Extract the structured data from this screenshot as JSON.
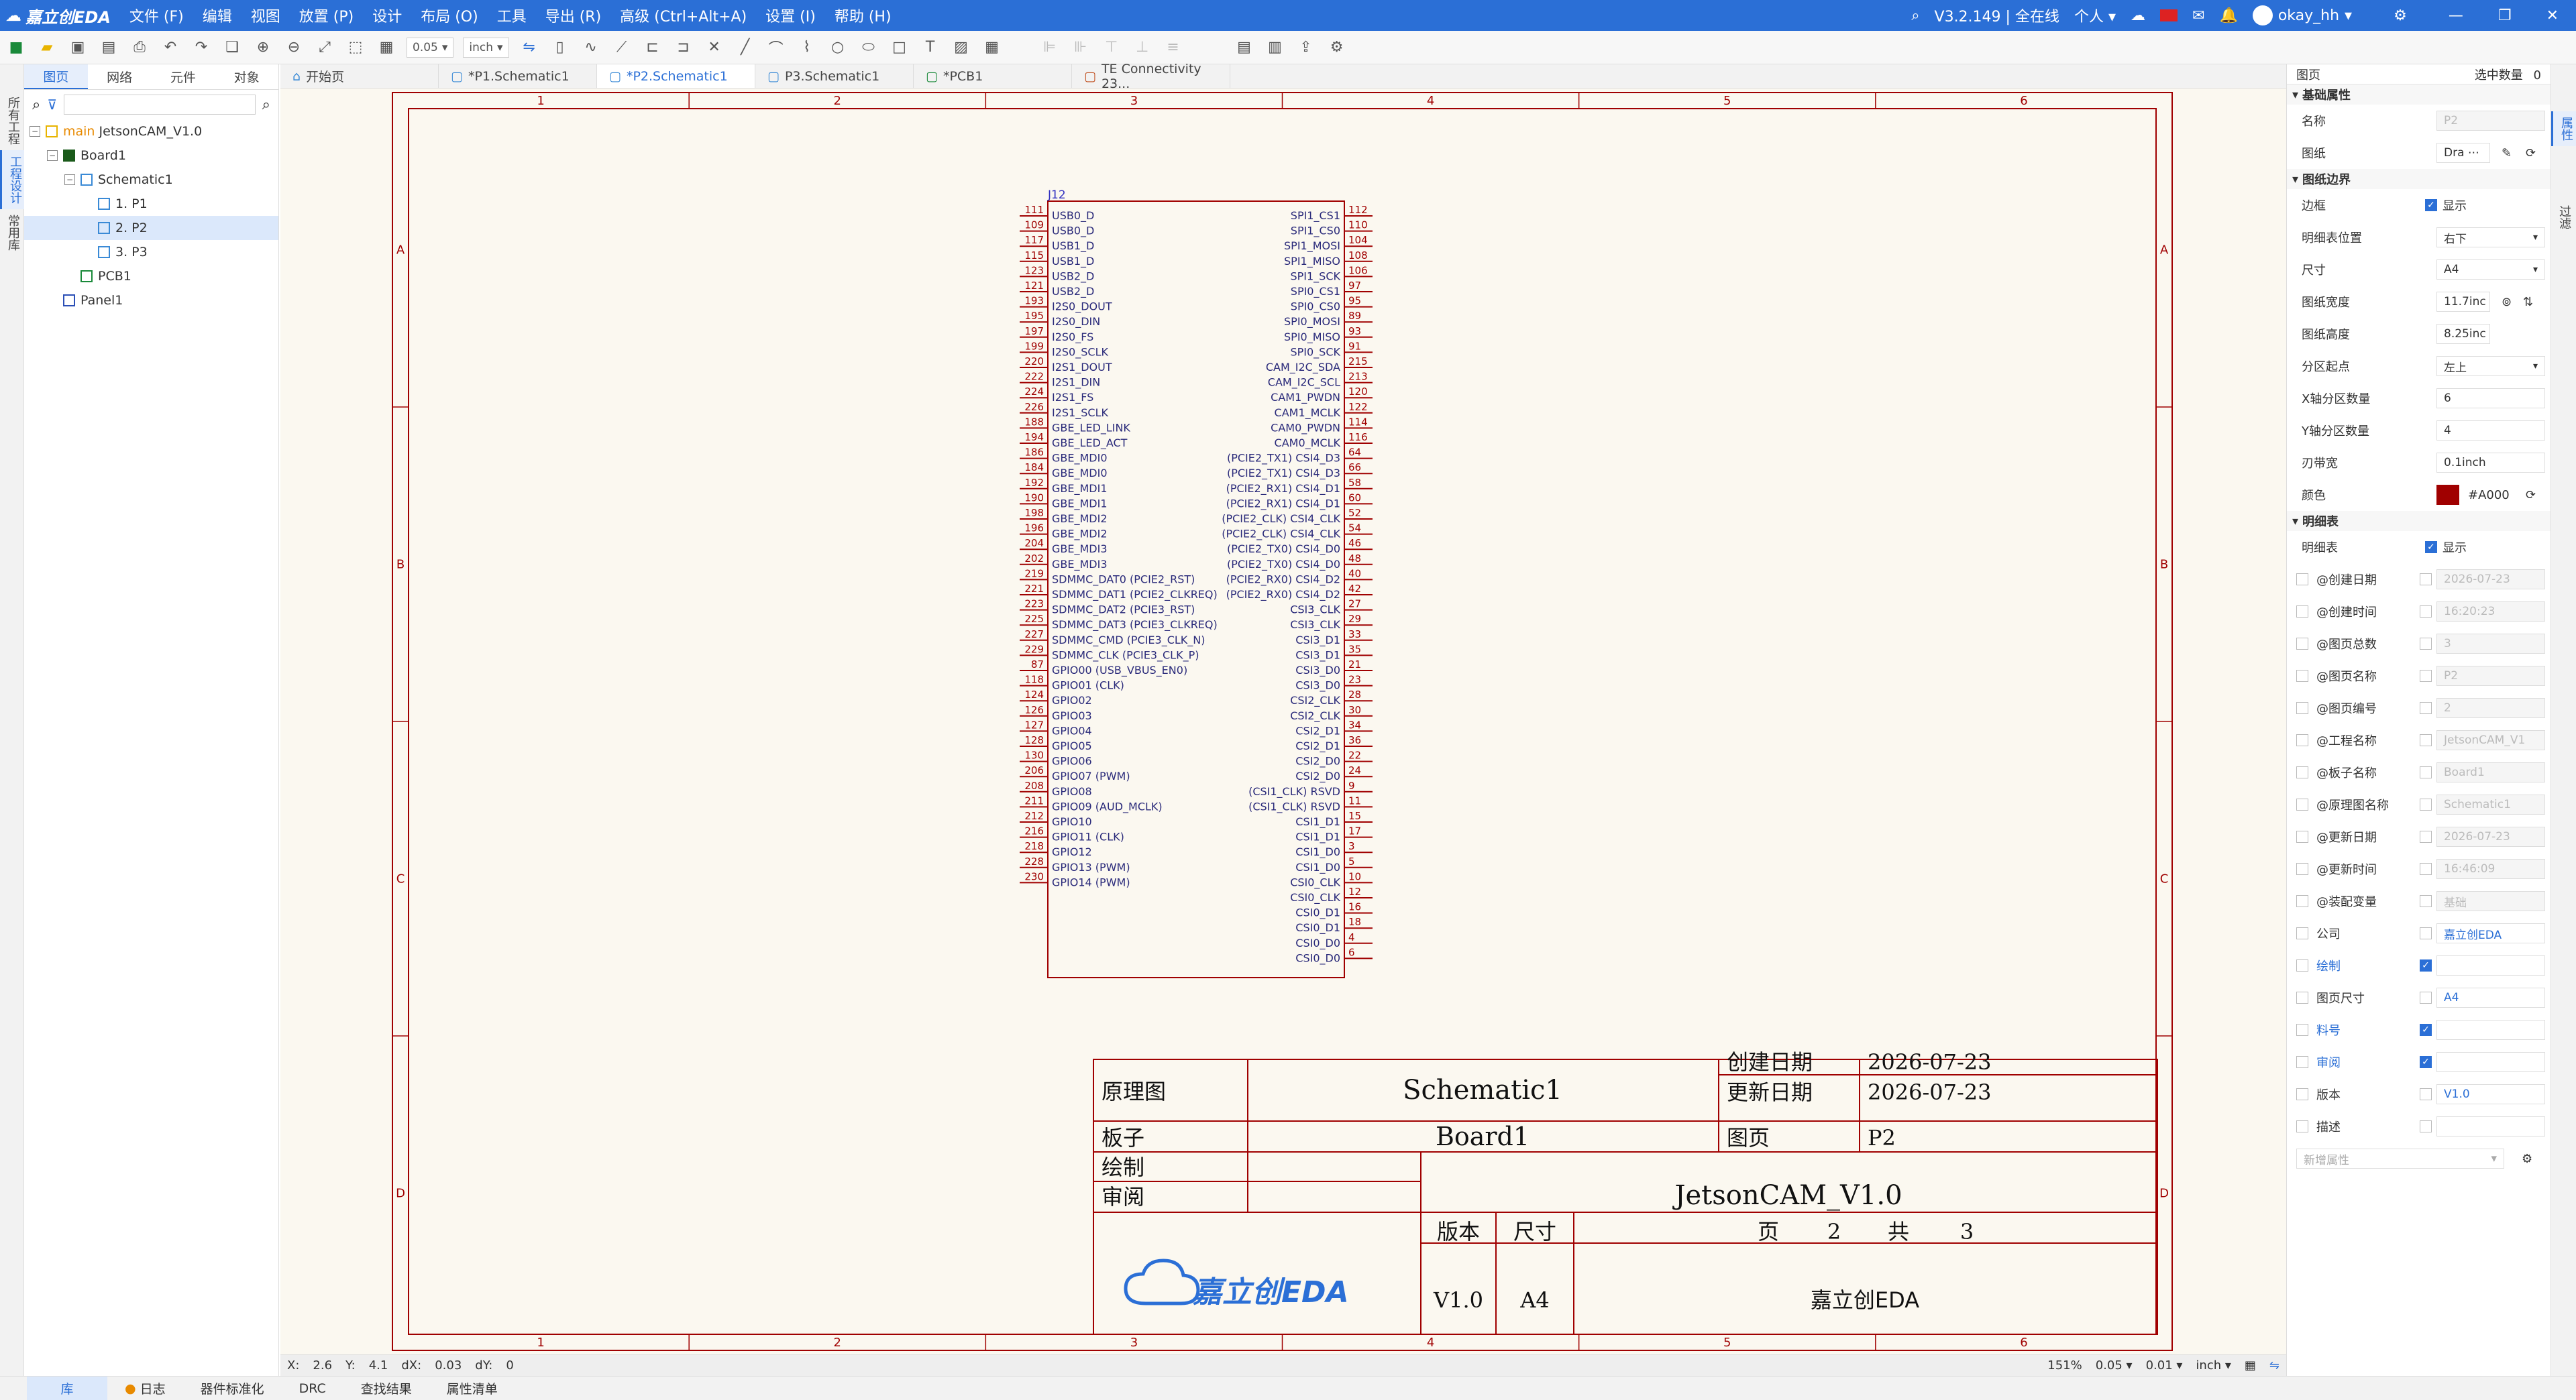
{
  "app": {
    "logo": "嘉立创EDA",
    "version": "V3.2.149 | 全在线",
    "mode": "个人",
    "user": "okay_hh"
  },
  "menus": [
    "文件 (F)",
    "编辑",
    "视图",
    "放置 (P)",
    "设计",
    "布局 (O)",
    "工具",
    "导出 (R)",
    "高级 (Ctrl+Alt+A)",
    "设置 (I)",
    "帮助 (H)"
  ],
  "toolbar": {
    "grid": "0.05",
    "unit": "inch"
  },
  "left_rail": [
    "所有工程",
    "工程设计",
    "常用库"
  ],
  "left_tabs": [
    "图页",
    "网络",
    "元件",
    "对象"
  ],
  "tree": [
    {
      "label": "main",
      "label2": "JetsonCAM_V1.0",
      "indent": 0,
      "icon": "folder"
    },
    {
      "label": "Board1",
      "indent": 1,
      "icon": "board"
    },
    {
      "label": "Schematic1",
      "indent": 2,
      "icon": "schematic"
    },
    {
      "label": "1. P1",
      "indent": 3,
      "icon": "page"
    },
    {
      "label": "2. P2",
      "indent": 3,
      "icon": "page",
      "selected": true
    },
    {
      "label": "3. P3",
      "indent": 3,
      "icon": "page"
    },
    {
      "label": "PCB1",
      "indent": 2,
      "icon": "pcb"
    },
    {
      "label": "Panel1",
      "indent": 1,
      "icon": "panel"
    }
  ],
  "doc_tabs": [
    "开始页",
    "*P1.Schematic1",
    "*P2.Schematic1",
    "P3.Schematic1",
    "*PCB1",
    "TE Connectivity 23..."
  ],
  "sheet": {
    "col_labels": [
      "1",
      "2",
      "3",
      "4",
      "5",
      "6"
    ],
    "row_labels": [
      "A",
      "B",
      "C",
      "D"
    ],
    "designator": "J12",
    "left_pins": [
      [
        "111",
        "USB0_D"
      ],
      [
        "109",
        "USB0_D"
      ],
      [
        "117",
        "USB1_D"
      ],
      [
        "115",
        "USB1_D"
      ],
      [
        "123",
        "USB2_D"
      ],
      [
        "121",
        "USB2_D"
      ],
      [
        "193",
        "I2S0_DOUT"
      ],
      [
        "195",
        "I2S0_DIN"
      ],
      [
        "197",
        "I2S0_FS"
      ],
      [
        "199",
        "I2S0_SCLK"
      ],
      [
        "220",
        "I2S1_DOUT"
      ],
      [
        "222",
        "I2S1_DIN"
      ],
      [
        "224",
        "I2S1_FS"
      ],
      [
        "226",
        "I2S1_SCLK"
      ],
      [
        "188",
        "GBE_LED_LINK"
      ],
      [
        "194",
        "GBE_LED_ACT"
      ],
      [
        "186",
        "GBE_MDI0"
      ],
      [
        "184",
        "GBE_MDI0"
      ],
      [
        "192",
        "GBE_MDI1"
      ],
      [
        "190",
        "GBE_MDI1"
      ],
      [
        "198",
        "GBE_MDI2"
      ],
      [
        "196",
        "GBE_MDI2"
      ],
      [
        "204",
        "GBE_MDI3"
      ],
      [
        "202",
        "GBE_MDI3"
      ],
      [
        "219",
        "SDMMC_DAT0 (PCIE2_RST)"
      ],
      [
        "221",
        "SDMMC_DAT1 (PCIE2_CLKREQ)"
      ],
      [
        "223",
        "SDMMC_DAT2 (PCIE3_RST)"
      ],
      [
        "225",
        "SDMMC_DAT3 (PCIE3_CLKREQ)"
      ],
      [
        "227",
        "SDMMC_CMD (PCIE3_CLK_N)"
      ],
      [
        "229",
        "SDMMC_CLK (PCIE3_CLK_P)"
      ],
      [
        "87",
        "GPIO00 (USB_VBUS_EN0)"
      ],
      [
        "118",
        "GPIO01 (CLK)"
      ],
      [
        "124",
        "GPIO02"
      ],
      [
        "126",
        "GPIO03"
      ],
      [
        "127",
        "GPIO04"
      ],
      [
        "128",
        "GPIO05"
      ],
      [
        "130",
        "GPIO06"
      ],
      [
        "206",
        "GPIO07 (PWM)"
      ],
      [
        "208",
        "GPIO08"
      ],
      [
        "211",
        "GPIO09 (AUD_MCLK)"
      ],
      [
        "212",
        "GPIO10"
      ],
      [
        "216",
        "GPIO11 (CLK)"
      ],
      [
        "218",
        "GPIO12"
      ],
      [
        "228",
        "GPIO13 (PWM)"
      ],
      [
        "230",
        "GPIO14 (PWM)"
      ]
    ],
    "right_pins": [
      [
        "112",
        "SPI1_CS1"
      ],
      [
        "110",
        "SPI1_CS0"
      ],
      [
        "104",
        "SPI1_MOSI"
      ],
      [
        "108",
        "SPI1_MISO"
      ],
      [
        "106",
        "SPI1_SCK"
      ],
      [
        "97",
        "SPI0_CS1"
      ],
      [
        "95",
        "SPI0_CS0"
      ],
      [
        "89",
        "SPI0_MOSI"
      ],
      [
        "93",
        "SPI0_MISO"
      ],
      [
        "91",
        "SPI0_SCK"
      ],
      [
        "215",
        "CAM_I2C_SDA"
      ],
      [
        "213",
        "CAM_I2C_SCL"
      ],
      [
        "120",
        "CAM1_PWDN"
      ],
      [
        "122",
        "CAM1_MCLK"
      ],
      [
        "114",
        "CAM0_PWDN"
      ],
      [
        "116",
        "CAM0_MCLK"
      ],
      [
        "64",
        "(PCIE2_TX1) CSI4_D3"
      ],
      [
        "66",
        "(PCIE2_TX1) CSI4_D3"
      ],
      [
        "58",
        "(PCIE2_RX1) CSI4_D1"
      ],
      [
        "60",
        "(PCIE2_RX1) CSI4_D1"
      ],
      [
        "52",
        "(PCIE2_CLK) CSI4_CLK"
      ],
      [
        "54",
        "(PCIE2_CLK) CSI4_CLK"
      ],
      [
        "46",
        "(PCIE2_TX0) CSI4_D0"
      ],
      [
        "48",
        "(PCIE2_TX0) CSI4_D0"
      ],
      [
        "40",
        "(PCIE2_RX0) CSI4_D2"
      ],
      [
        "42",
        "(PCIE2_RX0) CSI4_D2"
      ],
      [
        "27",
        "CSI3_CLK"
      ],
      [
        "29",
        "CSI3_CLK"
      ],
      [
        "33",
        "CSI3_D1"
      ],
      [
        "35",
        "CSI3_D1"
      ],
      [
        "21",
        "CSI3_D0"
      ],
      [
        "23",
        "CSI3_D0"
      ],
      [
        "28",
        "CSI2_CLK"
      ],
      [
        "30",
        "CSI2_CLK"
      ],
      [
        "34",
        "CSI2_D1"
      ],
      [
        "36",
        "CSI2_D1"
      ],
      [
        "22",
        "CSI2_D0"
      ],
      [
        "24",
        "CSI2_D0"
      ],
      [
        "9",
        "(CSI1_CLK) RSVD"
      ],
      [
        "11",
        "(CSI1_CLK) RSVD"
      ],
      [
        "15",
        "CSI1_D1"
      ],
      [
        "17",
        "CSI1_D1"
      ],
      [
        "3",
        "CSI1_D0"
      ],
      [
        "5",
        "CSI1_D0"
      ],
      [
        "10",
        "CSI0_CLK"
      ],
      [
        "12",
        "CSI0_CLK"
      ],
      [
        "16",
        "CSI0_D1"
      ],
      [
        "18",
        "CSI0_D1"
      ],
      [
        "4",
        "CSI0_D0"
      ],
      [
        "6",
        "CSI0_D0"
      ]
    ],
    "titleblock": {
      "l_schematic": "原理图",
      "schematic": "Schematic1",
      "l_created": "创建日期",
      "created": "2026-07-23",
      "l_updated": "更新日期",
      "updated": "2026-07-23",
      "l_board": "板子",
      "board": "Board1",
      "l_page": "图页",
      "page": "P2",
      "l_drawn": "绘制",
      "l_review": "审阅",
      "project": "JetsonCAM_V1.0",
      "l_version": "版本",
      "l_size": "尺寸",
      "l_ye": "页",
      "l_gong": "共",
      "page_no": "2",
      "page_total": "3",
      "version": "V1.0",
      "size": "A4",
      "logo": "嘉立创EDA",
      "company": "嘉立创EDA"
    }
  },
  "status": {
    "x_label": "X:",
    "x": "2.6",
    "y_label": "Y:",
    "y": "4.1",
    "dx_label": "dX:",
    "dx": "0.03",
    "dy_label": "dY:",
    "dy": "0",
    "zoom": "151%",
    "grid1": "0.05",
    "grid2": "0.01",
    "unit": "inch"
  },
  "bottom_tabs": [
    "库",
    "日志",
    "器件标准化",
    "DRC",
    "查找结果",
    "属性清单"
  ],
  "right_panel": {
    "head": "图页",
    "head_right": "选中数量",
    "count": "0",
    "sec_basic": "基础属性",
    "name_label": "名称",
    "name_value": "P2",
    "drawing_label": "图纸",
    "drawing_value": "Dra",
    "sec_border": "图纸边界",
    "border_label": "边框",
    "show": "显示",
    "rows": [
      [
        "明细表位置",
        "右下"
      ],
      [
        "尺寸",
        "A4"
      ],
      [
        "图纸宽度",
        "11.7inc"
      ],
      [
        "图纸高度",
        "8.25inc"
      ],
      [
        "分区起点",
        "左上"
      ],
      [
        "X轴分区数量",
        "6"
      ],
      [
        "Y轴分区数量",
        "4"
      ],
      [
        "刃带宽",
        "0.1inch"
      ]
    ],
    "color_label": "颜色",
    "color_value": "#A000",
    "color_hex": "#a00000",
    "sec_table": "明细表",
    "table_label": "明细表",
    "table_show": "显示",
    "attrs": [
      [
        "@创建日期",
        "2026-07-23",
        false,
        false
      ],
      [
        "@创建时间",
        "16:20:23",
        false,
        false
      ],
      [
        "@图页总数",
        "3",
        false,
        false
      ],
      [
        "@图页名称",
        "P2",
        false,
        false
      ],
      [
        "@图页编号",
        "2",
        false,
        false
      ],
      [
        "@工程名称",
        "JetsonCAM_V1",
        false,
        false
      ],
      [
        "@板子名称",
        "Board1",
        false,
        false
      ],
      [
        "@原理图名称",
        "Schematic1",
        false,
        false
      ],
      [
        "@更新日期",
        "2026-07-23",
        false,
        false
      ],
      [
        "@更新时间",
        "16:46:09",
        false,
        false
      ],
      [
        "@装配变量",
        "基础",
        false,
        false
      ],
      [
        "公司",
        "嘉立创EDA",
        false,
        false
      ],
      [
        "绘制",
        "",
        false,
        true
      ],
      [
        "图页尺寸",
        "A4",
        false,
        false
      ],
      [
        "料号",
        "",
        false,
        true
      ],
      [
        "审阅",
        "",
        false,
        true
      ],
      [
        "版本",
        "V1.0",
        false,
        false
      ],
      [
        "描述",
        "",
        false,
        false
      ]
    ],
    "add_attr": "新增属性"
  },
  "right_rail": [
    "属性",
    "过滤"
  ]
}
